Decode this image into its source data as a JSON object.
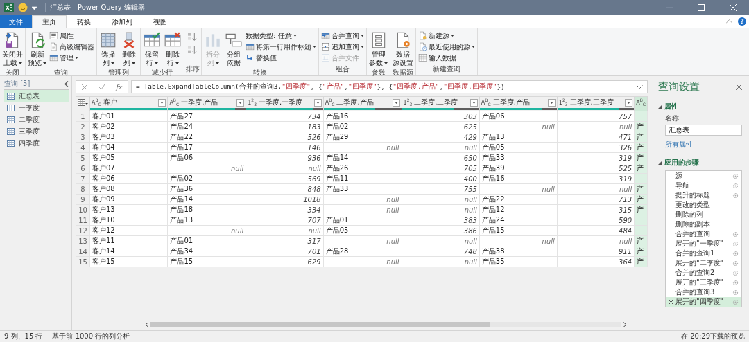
{
  "window": {
    "title": "汇总表 - Power Query 编辑器",
    "help": "?"
  },
  "tabs": [
    {
      "label": "文件",
      "kind": "file",
      "selected": false
    },
    {
      "label": "主页",
      "kind": "tab",
      "selected": true
    },
    {
      "label": "转换",
      "kind": "tab",
      "selected": false
    },
    {
      "label": "添加列",
      "kind": "tab",
      "selected": false
    },
    {
      "label": "视图",
      "kind": "tab",
      "selected": false
    }
  ],
  "ribbon": {
    "groups": [
      {
        "label": "关闭",
        "buttons": [
          {
            "kind": "large",
            "lines": [
              "关闭并",
              "上载"
            ],
            "dropdown": true,
            "disabled": false
          }
        ]
      },
      {
        "label": "查询",
        "buttons": [
          {
            "kind": "large",
            "lines": [
              "刷新",
              "预览"
            ],
            "dropdown": true,
            "disabled": false
          },
          {
            "kind": "small",
            "label": "属性",
            "dropdown": false,
            "disabled": false
          },
          {
            "kind": "small",
            "label": "高级编辑器",
            "dropdown": false,
            "disabled": false
          },
          {
            "kind": "small",
            "label": "管理",
            "dropdown": true,
            "disabled": false
          }
        ]
      },
      {
        "label": "管理列",
        "buttons": [
          {
            "kind": "large",
            "lines": [
              "选择",
              "列"
            ],
            "dropdown": true,
            "disabled": false
          },
          {
            "kind": "large",
            "lines": [
              "删除",
              "列"
            ],
            "dropdown": true,
            "disabled": false
          }
        ]
      },
      {
        "label": "减少行",
        "buttons": [
          {
            "kind": "large",
            "lines": [
              "保留",
              "行"
            ],
            "dropdown": true,
            "disabled": false
          },
          {
            "kind": "large",
            "lines": [
              "删除",
              "行"
            ],
            "dropdown": true,
            "disabled": false
          }
        ]
      },
      {
        "label": "排序",
        "buttons": [
          {
            "kind": "icon",
            "disabled": false
          },
          {
            "kind": "icon",
            "disabled": false
          }
        ]
      },
      {
        "label": "转换",
        "buttons": [
          {
            "kind": "large",
            "lines": [
              "拆分",
              "列"
            ],
            "dropdown": true,
            "disabled": true
          },
          {
            "kind": "large",
            "lines": [
              "分组",
              "依据"
            ],
            "dropdown": false,
            "disabled": false
          },
          {
            "kind": "small",
            "label": "数据类型: 任意",
            "dropdown": true,
            "disabled": false
          },
          {
            "kind": "small",
            "label": "将第一行用作标题",
            "dropdown": true,
            "disabled": false
          },
          {
            "kind": "small",
            "label": "替换值",
            "dropdown": false,
            "disabled": false
          }
        ]
      },
      {
        "label": "组合",
        "buttons": [
          {
            "kind": "small",
            "label": "合并查询",
            "dropdown": true,
            "disabled": false
          },
          {
            "kind": "small",
            "label": "追加查询",
            "dropdown": true,
            "disabled": false
          },
          {
            "kind": "small",
            "label": "合并文件",
            "dropdown": false,
            "disabled": true
          }
        ]
      },
      {
        "label": "参数",
        "buttons": [
          {
            "kind": "large",
            "lines": [
              "管理",
              "参数"
            ],
            "dropdown": true,
            "disabled": false
          }
        ]
      },
      {
        "label": "数据源",
        "buttons": [
          {
            "kind": "large",
            "lines": [
              "数据",
              "源设置"
            ],
            "dropdown": false,
            "disabled": false
          }
        ]
      },
      {
        "label": "新建查询",
        "buttons": [
          {
            "kind": "small",
            "label": "新建源",
            "dropdown": true,
            "disabled": false
          },
          {
            "kind": "small",
            "label": "最近使用的源",
            "dropdown": true,
            "disabled": false
          },
          {
            "kind": "small",
            "label": "输入数据",
            "dropdown": false,
            "disabled": false
          }
        ]
      }
    ]
  },
  "queries": {
    "header": "查询 [5]",
    "items": [
      {
        "label": "汇总表",
        "selected": true
      },
      {
        "label": "一季度",
        "selected": false
      },
      {
        "label": "二季度",
        "selected": false
      },
      {
        "label": "三季度",
        "selected": false
      },
      {
        "label": "四季度",
        "selected": false
      }
    ]
  },
  "formula_bar": {
    "fx": "fx",
    "tokens": [
      {
        "text": "= Table.ExpandTableColumn(合并的查询3, ",
        "kind": "plain"
      },
      {
        "text": "\"四季度\"",
        "kind": "string"
      },
      {
        "text": ", {",
        "kind": "plain"
      },
      {
        "text": "\"产品\"",
        "kind": "string"
      },
      {
        "text": ", ",
        "kind": "plain"
      },
      {
        "text": "\"四季度\"",
        "kind": "string"
      },
      {
        "text": "}, {",
        "kind": "plain"
      },
      {
        "text": "\"四季度.产品\"",
        "kind": "string"
      },
      {
        "text": ", ",
        "kind": "plain"
      },
      {
        "text": "\"四季度.四季度\"",
        "kind": "string"
      },
      {
        "text": "})",
        "kind": "plain"
      }
    ]
  },
  "table": {
    "columns": [
      {
        "title": "客户",
        "kind": "text",
        "type_label": "A$^{B}$$_{C}$",
        "level": 1,
        "selected": false
      },
      {
        "title": "一季度.产品",
        "kind": "text",
        "type_label": "A$^{B}$$_{C}$",
        "level": 0.867,
        "selected": false
      },
      {
        "title": "一季度.一季度",
        "kind": "number",
        "type_label": "1$^{2}$$_{3}$",
        "level": 0.867,
        "selected": false
      },
      {
        "title": "二季度.产品",
        "kind": "text",
        "type_label": "A$^{B}$$_{C}$",
        "level": 0.667,
        "selected": false
      },
      {
        "title": "二季度.二季度",
        "kind": "number",
        "type_label": "1$^{2}$$_{3}$",
        "level": 0.667,
        "selected": false
      },
      {
        "title": "三季度.产品",
        "kind": "text",
        "type_label": "A$^{B}$$_{C}$",
        "level": 0.8,
        "selected": false
      },
      {
        "title": "三季度.三季度",
        "kind": "number",
        "type_label": "1$^{2}$$_{3}$",
        "level": 0.8,
        "selected": false
      },
      {
        "kind": "text",
        "type_label": "A$^{B}$$_{C}$",
        "selected": true
      }
    ],
    "rows": [
      {
        "number": "1",
        "cells": [
          "客户01",
          "产品27",
          "734",
          "产品16",
          "303",
          "产品06",
          "757",
          null
        ]
      },
      {
        "number": "2",
        "cells": [
          "客户02",
          "产品24",
          "183",
          "产品02",
          "625",
          {
            "text": "null",
            "is_null": true
          },
          {
            "text": "null",
            "is_null": true
          },
          "产"
        ]
      },
      {
        "number": "3",
        "cells": [
          "客户03",
          "产品22",
          "526",
          "产品29",
          "429",
          "产品13",
          "471",
          "产"
        ]
      },
      {
        "number": "4",
        "cells": [
          "客户04",
          "产品17",
          "146",
          {
            "text": "null",
            "is_null": true
          },
          {
            "text": "null",
            "is_null": true
          },
          "产品05",
          "326",
          "产"
        ]
      },
      {
        "number": "5",
        "cells": [
          "客户05",
          "产品06",
          "936",
          "产品14",
          "650",
          "产品33",
          "319",
          "产"
        ]
      },
      {
        "number": "6",
        "cells": [
          "客户07",
          {
            "text": "null",
            "is_null": true
          },
          {
            "text": "null",
            "is_null": true
          },
          "产品26",
          "705",
          "产品39",
          "525",
          "产"
        ]
      },
      {
        "number": "7",
        "cells": [
          "客户06",
          "产品02",
          "569",
          "产品11",
          "400",
          "产品16",
          "319",
          null
        ]
      },
      {
        "number": "8",
        "cells": [
          "客户08",
          "产品36",
          "848",
          "产品33",
          "755",
          {
            "text": "null",
            "is_null": true
          },
          {
            "text": "null",
            "is_null": true
          },
          "产"
        ]
      },
      {
        "number": "9",
        "cells": [
          "客户09",
          "产品14",
          "1018",
          {
            "text": "null",
            "is_null": true
          },
          {
            "text": "null",
            "is_null": true
          },
          "产品22",
          "713",
          "产"
        ]
      },
      {
        "number": "10",
        "cells": [
          "客户13",
          "产品18",
          "334",
          {
            "text": "null",
            "is_null": true
          },
          {
            "text": "null",
            "is_null": true
          },
          "产品12",
          "315",
          "产"
        ]
      },
      {
        "number": "11",
        "cells": [
          "客户10",
          "产品13",
          "707",
          "产品01",
          "383",
          "产品24",
          "590",
          null
        ]
      },
      {
        "number": "12",
        "cells": [
          "客户12",
          {
            "text": "null",
            "is_null": true
          },
          {
            "text": "null",
            "is_null": true
          },
          "产品05",
          "386",
          "产品15",
          "484",
          null
        ]
      },
      {
        "number": "13",
        "cells": [
          "客户11",
          "产品01",
          "317",
          {
            "text": "null",
            "is_null": true
          },
          {
            "text": "null",
            "is_null": true
          },
          {
            "text": "null",
            "is_null": true
          },
          {
            "text": "null",
            "is_null": true
          },
          "产"
        ]
      },
      {
        "number": "14",
        "cells": [
          "客户14",
          "产品34",
          "701",
          "产品28",
          "748",
          "产品38",
          "911",
          "产"
        ]
      },
      {
        "number": "15",
        "cells": [
          "客户15",
          "产品15",
          "629",
          {
            "text": "null",
            "is_null": true
          },
          {
            "text": "null",
            "is_null": true
          },
          "产品35",
          "364",
          "产"
        ]
      }
    ]
  },
  "settings": {
    "title": "查询设置",
    "properties_header": "属性",
    "name_label": "名称",
    "name_value": "汇总表",
    "all_properties": "所有属性",
    "steps_header": "应用的步骤",
    "steps": [
      {
        "label": "源",
        "settings": true,
        "selected": false
      },
      {
        "label": "导航",
        "settings": true,
        "selected": false
      },
      {
        "label": "提升的标题",
        "settings": true,
        "selected": false
      },
      {
        "label": "更改的类型",
        "settings": false,
        "selected": false
      },
      {
        "label": "删除的列",
        "settings": false,
        "selected": false
      },
      {
        "label": "删除的副本",
        "settings": false,
        "selected": false
      },
      {
        "label": "合并的查询",
        "settings": true,
        "selected": false
      },
      {
        "label": "展开的\"一季度\"",
        "settings": true,
        "selected": false
      },
      {
        "label": "合并的查询1",
        "settings": true,
        "selected": false
      },
      {
        "label": "展开的\"二季度\"",
        "settings": true,
        "selected": false
      },
      {
        "label": "合并的查询2",
        "settings": true,
        "selected": false
      },
      {
        "label": "展开的\"三季度\"",
        "settings": true,
        "selected": false
      },
      {
        "label": "合并的查询3",
        "settings": true,
        "selected": false
      },
      {
        "label": "展开的\"四季度\"",
        "settings": true,
        "selected": true
      }
    ]
  },
  "status_bar": {
    "columns_rows": "9 列、15 行",
    "profiling": "基于前 1000 行的列分析",
    "preview": "在 20:29下载的预览"
  }
}
